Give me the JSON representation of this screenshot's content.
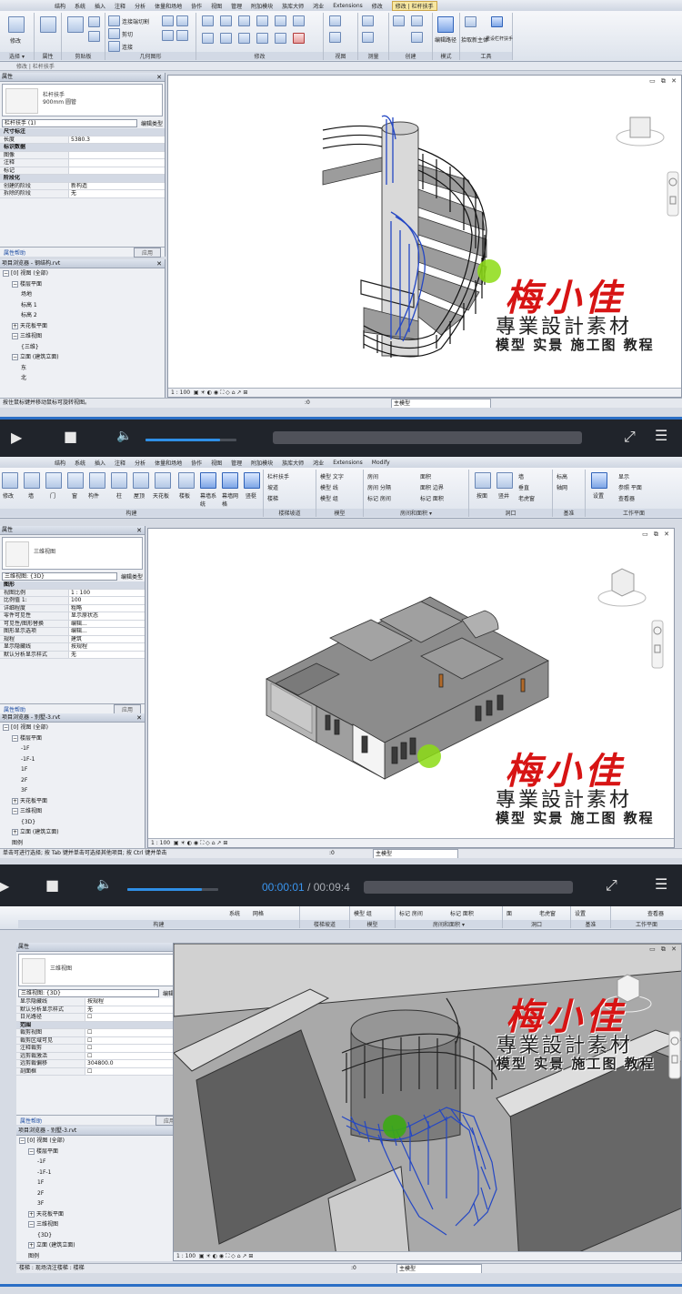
{
  "frame1": {
    "tabs": [
      "结构",
      "系统",
      "插入",
      "注释",
      "分析",
      "体量和场地",
      "协作",
      "视图",
      "管理",
      "附加模块",
      "族库大师",
      "鸿业",
      "Extensions",
      "修改",
      "修改 | 栏杆扶手"
    ],
    "active_tab": "修改 | 栏杆扶手",
    "panels": [
      {
        "label": "选择",
        "dropdown": "选择 ▾"
      },
      {
        "label": "属性"
      },
      {
        "label": "剪贴板"
      },
      {
        "label": "几何图形"
      },
      {
        "label": "修改"
      },
      {
        "label": "视图"
      },
      {
        "label": "测量"
      },
      {
        "label": "创建"
      },
      {
        "label": "模式"
      },
      {
        "label": "工具"
      }
    ],
    "ribbon_texts": {
      "cope": "连接端切割",
      "cut": "剪切",
      "join": "连接",
      "modify": "修改",
      "edit_path": "编辑路径",
      "pick_host": "拾取新主体",
      "reset_rail": "重设栏杆扶手"
    },
    "qat_text": "修改 | 栏杆扶手",
    "properties": {
      "title": "属性",
      "type_name": "栏杆扶手",
      "type_sub": "900mm 圆管",
      "selector": "栏杆扶手 (1)",
      "edit_type": "编辑类型",
      "rows": [
        {
          "k": "尺寸标注",
          "v": "",
          "group": true
        },
        {
          "k": "长度",
          "v": "5380.3",
          "group": false
        },
        {
          "k": "标识数据",
          "v": "",
          "group": true
        },
        {
          "k": "图像",
          "v": "",
          "group": false
        },
        {
          "k": "注释",
          "v": "",
          "group": false
        },
        {
          "k": "标记",
          "v": "",
          "group": false
        },
        {
          "k": "阶段化",
          "v": "",
          "group": true
        },
        {
          "k": "创建的阶段",
          "v": "新构造",
          "group": false
        },
        {
          "k": "拆除的阶段",
          "v": "无",
          "group": false
        }
      ],
      "help": "属性帮助",
      "apply": "应用"
    },
    "browser": {
      "title": "项目浏览器 - 钢结构.rvt",
      "rows": [
        {
          "indent": 0,
          "exp": "−",
          "text": "[0] 视图 (全部)"
        },
        {
          "indent": 1,
          "exp": "−",
          "text": "楼层平面"
        },
        {
          "indent": 2,
          "exp": "",
          "text": "场地"
        },
        {
          "indent": 2,
          "exp": "",
          "text": "标高 1"
        },
        {
          "indent": 2,
          "exp": "",
          "text": "标高 2"
        },
        {
          "indent": 1,
          "exp": "+",
          "text": "天花板平面"
        },
        {
          "indent": 1,
          "exp": "−",
          "text": "三维视图"
        },
        {
          "indent": 2,
          "exp": "",
          "text": "{三维}"
        },
        {
          "indent": 1,
          "exp": "−",
          "text": "立面 (建筑立面)"
        },
        {
          "indent": 2,
          "exp": "",
          "text": "东"
        },
        {
          "indent": 2,
          "exp": "",
          "text": "北"
        }
      ]
    },
    "scale": "1 : 100",
    "status": "按住鼠标键并移动鼠标可旋转视图。",
    "model_label": "主模型",
    "zero": ":0"
  },
  "player1": {
    "time_current": "",
    "time_total": ""
  },
  "frame2": {
    "tabs": [
      "结构",
      "系统",
      "插入",
      "注释",
      "分析",
      "体量和场地",
      "协作",
      "视图",
      "管理",
      "附加模块",
      "族库大师",
      "鸿业",
      "Extensions",
      "Modify"
    ],
    "panels": [
      {
        "label": "构建"
      },
      {
        "label": "楼梯坡道"
      },
      {
        "label": "模型"
      },
      {
        "label": "房间和面积 ▾"
      },
      {
        "label": "洞口"
      },
      {
        "label": "基准"
      },
      {
        "label": "工作平面"
      }
    ],
    "ribbon_texts": {
      "modify": "修改",
      "wall": "墙",
      "door": "门",
      "window": "窗",
      "component": "构件",
      "column": "柱",
      "roof": "屋顶",
      "ceiling": "天花板",
      "floor": "楼板",
      "curtain_system": "幕墙系统",
      "curtain_grid": "幕墙网格",
      "mullion": "竖梃",
      "railing": "栏杆扶手",
      "ramp": "坡道",
      "stair": "楼梯",
      "model_text": "模型 文字",
      "model_line": "模型 线",
      "model_group": "模型 组",
      "room": "房间",
      "room_sep": "房间 分隔",
      "tag_room": "标记 房间",
      "area": "面积",
      "area_boundary": "面积 边界",
      "tag_area": "标记 面积",
      "by_face": "按面",
      "shaft": "竖井",
      "wall_op": "墙",
      "vertical": "垂直",
      "dormer": "老虎窗",
      "level": "标高",
      "grid": "轴网",
      "set": "设置",
      "show": "显示",
      "ref_plane": "参照 平面",
      "viewer": "查看器"
    },
    "properties": {
      "title": "属性",
      "type_name": "三维视图",
      "selector": "三维视图: {3D}",
      "edit_type": "编辑类型",
      "rows": [
        {
          "k": "图形",
          "v": "",
          "group": true
        },
        {
          "k": "视图比例",
          "v": "1 : 100",
          "group": false
        },
        {
          "k": "比例值 1:",
          "v": "100",
          "group": false
        },
        {
          "k": "详细程度",
          "v": "粗略",
          "group": false
        },
        {
          "k": "零件可见性",
          "v": "显示原状态",
          "group": false
        },
        {
          "k": "可见性/图形替换",
          "v": "编辑...",
          "group": false
        },
        {
          "k": "图形显示选项",
          "v": "编辑...",
          "group": false
        },
        {
          "k": "规程",
          "v": "建筑",
          "group": false
        },
        {
          "k": "显示隐藏线",
          "v": "按规程",
          "group": false
        },
        {
          "k": "默认分析显示样式",
          "v": "无",
          "group": false
        }
      ],
      "help": "属性帮助",
      "apply": "应用"
    },
    "browser": {
      "title": "项目浏览器 - 别墅-3.rvt",
      "rows": [
        {
          "indent": 0,
          "exp": "−",
          "text": "[0] 视图 (全部)"
        },
        {
          "indent": 1,
          "exp": "−",
          "text": "楼层平面"
        },
        {
          "indent": 2,
          "exp": "",
          "text": "-1F"
        },
        {
          "indent": 2,
          "exp": "",
          "text": "-1F-1"
        },
        {
          "indent": 2,
          "exp": "",
          "text": "1F"
        },
        {
          "indent": 2,
          "exp": "",
          "text": "2F"
        },
        {
          "indent": 2,
          "exp": "",
          "text": "3F"
        },
        {
          "indent": 1,
          "exp": "+",
          "text": "天花板平面"
        },
        {
          "indent": 1,
          "exp": "−",
          "text": "三维视图"
        },
        {
          "indent": 2,
          "exp": "",
          "text": "{3D}"
        },
        {
          "indent": 1,
          "exp": "+",
          "text": "立面 (建筑立面)"
        },
        {
          "indent": 1,
          "exp": "",
          "text": "图例"
        }
      ]
    },
    "scale": "1 : 100",
    "status": "单击可进行选择; 按 Tab 键并单击可选择其他项目; 按 Ctrl 键并单击",
    "model_label": "主模型",
    "zero": ":0"
  },
  "player2": {
    "time_current": "00:00:01",
    "time_separator": "/",
    "time_total": "00:09:4"
  },
  "frame3": {
    "ribbon_texts": {
      "system": "系统",
      "grid": "网格",
      "model_group": "模型 组",
      "tag_room": "标记 房间",
      "tag_area": "标记 面积",
      "dormer": "老虎窗",
      "face": "面",
      "set_label": "设置",
      "viewer": "查看器"
    },
    "panels": [
      {
        "label": "构建"
      },
      {
        "label": "楼梯坡道"
      },
      {
        "label": "模型"
      },
      {
        "label": "房间和面积 ▾"
      },
      {
        "label": "洞口"
      },
      {
        "label": "基准"
      },
      {
        "label": "工作平面"
      }
    ],
    "properties": {
      "title": "属性",
      "type_name": "三维视图",
      "selector": "三维视图: {3D}",
      "edit_type": "编辑类型",
      "rows": [
        {
          "k": "显示隐藏线",
          "v": "按规程",
          "group": false
        },
        {
          "k": "默认分析显示样式",
          "v": "无",
          "group": false
        },
        {
          "k": "日光路径",
          "v": "☐",
          "group": false
        },
        {
          "k": "范围",
          "v": "",
          "group": true
        },
        {
          "k": "裁剪视图",
          "v": "☐",
          "group": false
        },
        {
          "k": "裁剪区域可见",
          "v": "☐",
          "group": false
        },
        {
          "k": "注释裁剪",
          "v": "☐",
          "group": false
        },
        {
          "k": "远剪裁激活",
          "v": "☐",
          "group": false
        },
        {
          "k": "远剪裁偏移",
          "v": "304800.0",
          "group": false
        },
        {
          "k": "剖面框",
          "v": "☐",
          "group": false
        }
      ],
      "help": "属性帮助",
      "apply": "应用"
    },
    "browser": {
      "title": "项目浏览器 - 别墅-3.rvt",
      "rows": [
        {
          "indent": 0,
          "exp": "−",
          "text": "[0] 视图 (全部)"
        },
        {
          "indent": 1,
          "exp": "−",
          "text": "楼层平面"
        },
        {
          "indent": 2,
          "exp": "",
          "text": "-1F"
        },
        {
          "indent": 2,
          "exp": "",
          "text": "-1F-1"
        },
        {
          "indent": 2,
          "exp": "",
          "text": "1F"
        },
        {
          "indent": 2,
          "exp": "",
          "text": "2F"
        },
        {
          "indent": 2,
          "exp": "",
          "text": "3F"
        },
        {
          "indent": 1,
          "exp": "+",
          "text": "天花板平面"
        },
        {
          "indent": 1,
          "exp": "−",
          "text": "三维视图"
        },
        {
          "indent": 2,
          "exp": "",
          "text": "{3D}"
        },
        {
          "indent": 1,
          "exp": "+",
          "text": "立面 (建筑立面)"
        },
        {
          "indent": 1,
          "exp": "",
          "text": "图例"
        }
      ]
    },
    "scale": "1 : 100",
    "status": "楼梯 : 现场浇注楼梯 : 楼梯",
    "model_label": "主模型",
    "zero": ":0"
  },
  "watermark": {
    "logo": "梅小佳",
    "line1": "專業設計素材",
    "line2": "模型 实景 施工图 教程"
  },
  "colors": {
    "accent_blue": "#2f8fe6",
    "watermark_red": "#d71414",
    "cursor_green": "#8cdc14",
    "railing_blue": "#2447c4"
  }
}
